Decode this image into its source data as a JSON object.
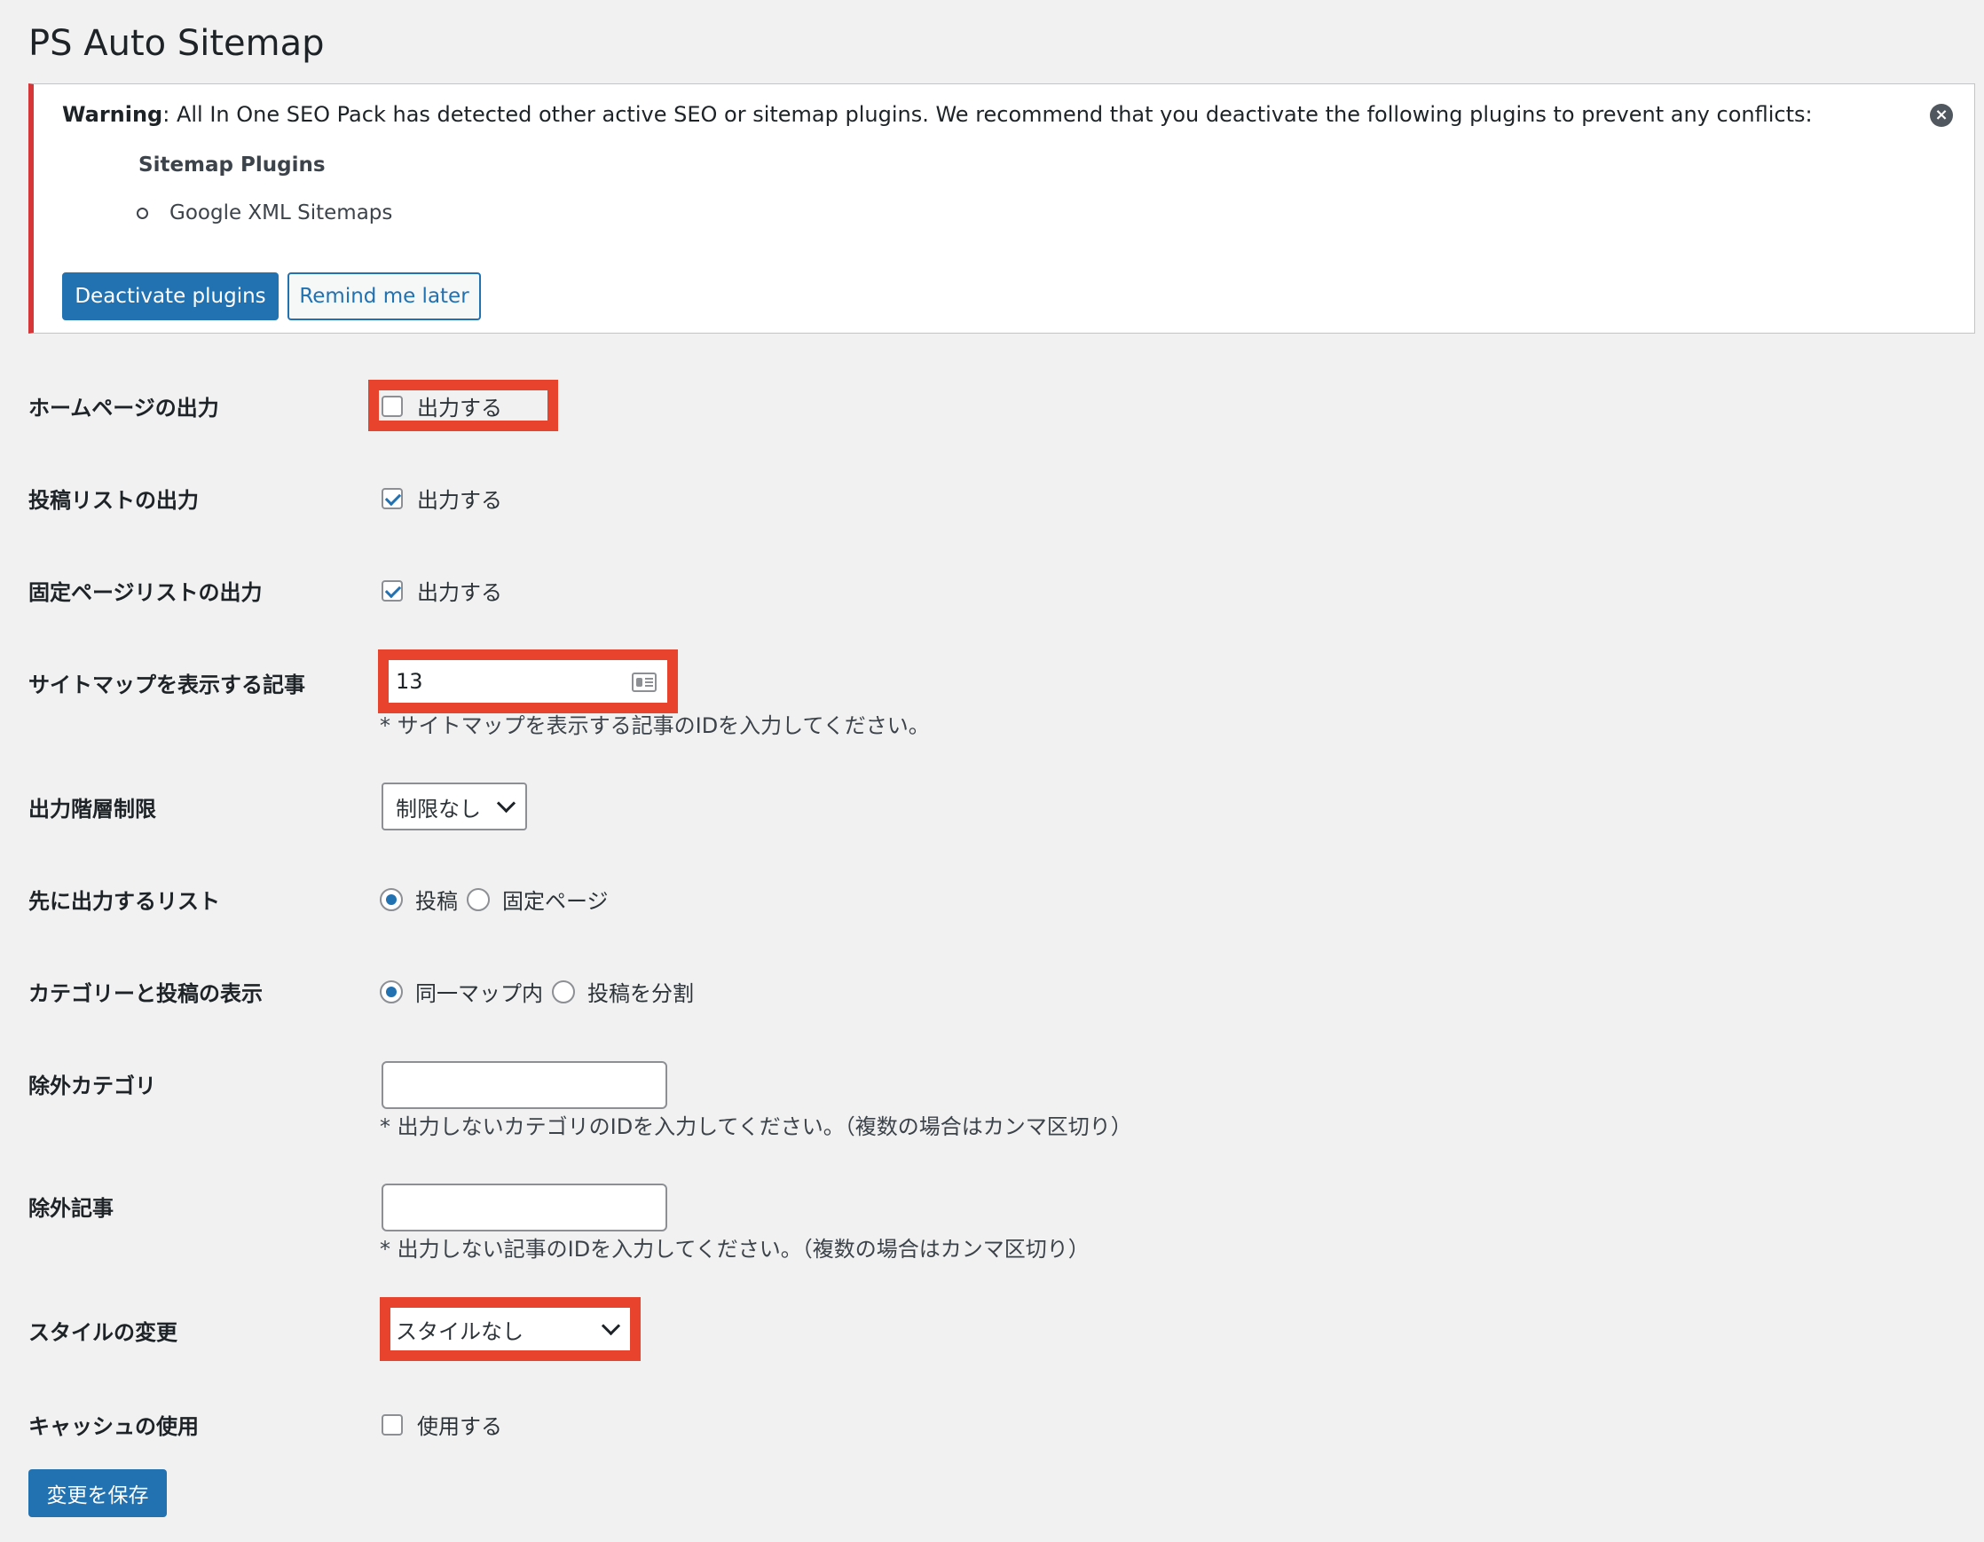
{
  "page": {
    "title": "PS Auto Sitemap"
  },
  "notice": {
    "warning_label": "Warning",
    "warning_text": ": All In One SEO Pack has detected other active SEO or sitemap plugins. We recommend that you deactivate the following plugins to prevent any conflicts:",
    "subheading": "Sitemap Plugins",
    "plugins": [
      "Google XML Sitemaps"
    ],
    "deactivate_label": "Deactivate plugins",
    "remind_label": "Remind me later",
    "dismiss_glyph": "×"
  },
  "form": {
    "home_output": {
      "label": "ホームページの出力",
      "option": "出力する",
      "checked": false
    },
    "post_list": {
      "label": "投稿リストの出力",
      "option": "出力する",
      "checked": true
    },
    "page_list": {
      "label": "固定ページリストの出力",
      "option": "出力する",
      "checked": true
    },
    "sitemap_post": {
      "label": "サイトマップを表示する記事",
      "value": "13",
      "description": "* サイトマップを表示する記事のIDを入力してください。"
    },
    "depth_limit": {
      "label": "出力階層制限",
      "selected": "制限なし"
    },
    "first_list": {
      "label": "先に出力するリスト",
      "options": [
        "投稿",
        "固定ページ"
      ],
      "selected_index": 0
    },
    "category_display": {
      "label": "カテゴリーと投稿の表示",
      "options": [
        "同一マップ内",
        "投稿を分割"
      ],
      "selected_index": 0
    },
    "exclude_category": {
      "label": "除外カテゴリ",
      "value": "",
      "description": "* 出力しないカテゴリのIDを入力してください。（複数の場合はカンマ区切り）"
    },
    "exclude_post": {
      "label": "除外記事",
      "value": "",
      "description": "* 出力しない記事のIDを入力してください。（複数の場合はカンマ区切り）"
    },
    "style": {
      "label": "スタイルの変更",
      "selected": "スタイルなし"
    },
    "cache": {
      "label": "キャッシュの使用",
      "option": "使用する",
      "checked": false
    },
    "save_label": "変更を保存"
  },
  "colors": {
    "primary": "#2271b1",
    "error": "#d63638",
    "highlight": "#e8432d",
    "background": "#f1f1f1"
  }
}
